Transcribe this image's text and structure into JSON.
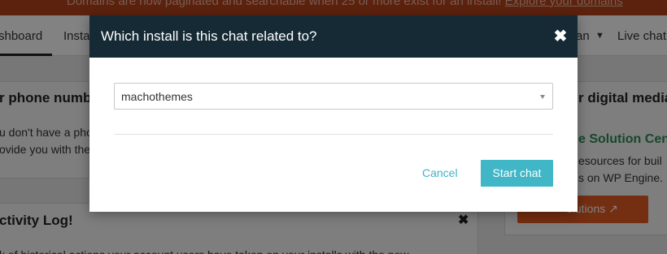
{
  "banner": {
    "message": "Domains are now paginated and searchable when 25 or more exist for an install!",
    "link": "Explore your domains"
  },
  "topnav": {
    "items": [
      "shboard",
      "Insta",
      "an",
      "Live chat"
    ],
    "dropdown_icon": "caret-down-icon"
  },
  "panels": {
    "phone": {
      "title": "r phone numb",
      "lines": [
        "u don't have a pho",
        "ovide you with the"
      ]
    },
    "media": {
      "title": "r digital media",
      "link": "e Solution Cen",
      "lines": [
        "esources for buil",
        "s on WP Engine."
      ],
      "button": "olutions"
    },
    "activity": {
      "title": "ctivity Log!",
      "text": "k of historical actions your account users have taken on your installs with the new"
    }
  },
  "modal": {
    "title": "Which install is this chat related to?",
    "close_icon": "close-icon",
    "select_value": "machothemes",
    "cancel_label": "Cancel",
    "start_label": "Start chat"
  },
  "colors": {
    "header_bg": "#162a35",
    "accent": "#40b6c6",
    "banner_bg": "#b4431a",
    "cta_orange": "#e45a22"
  }
}
